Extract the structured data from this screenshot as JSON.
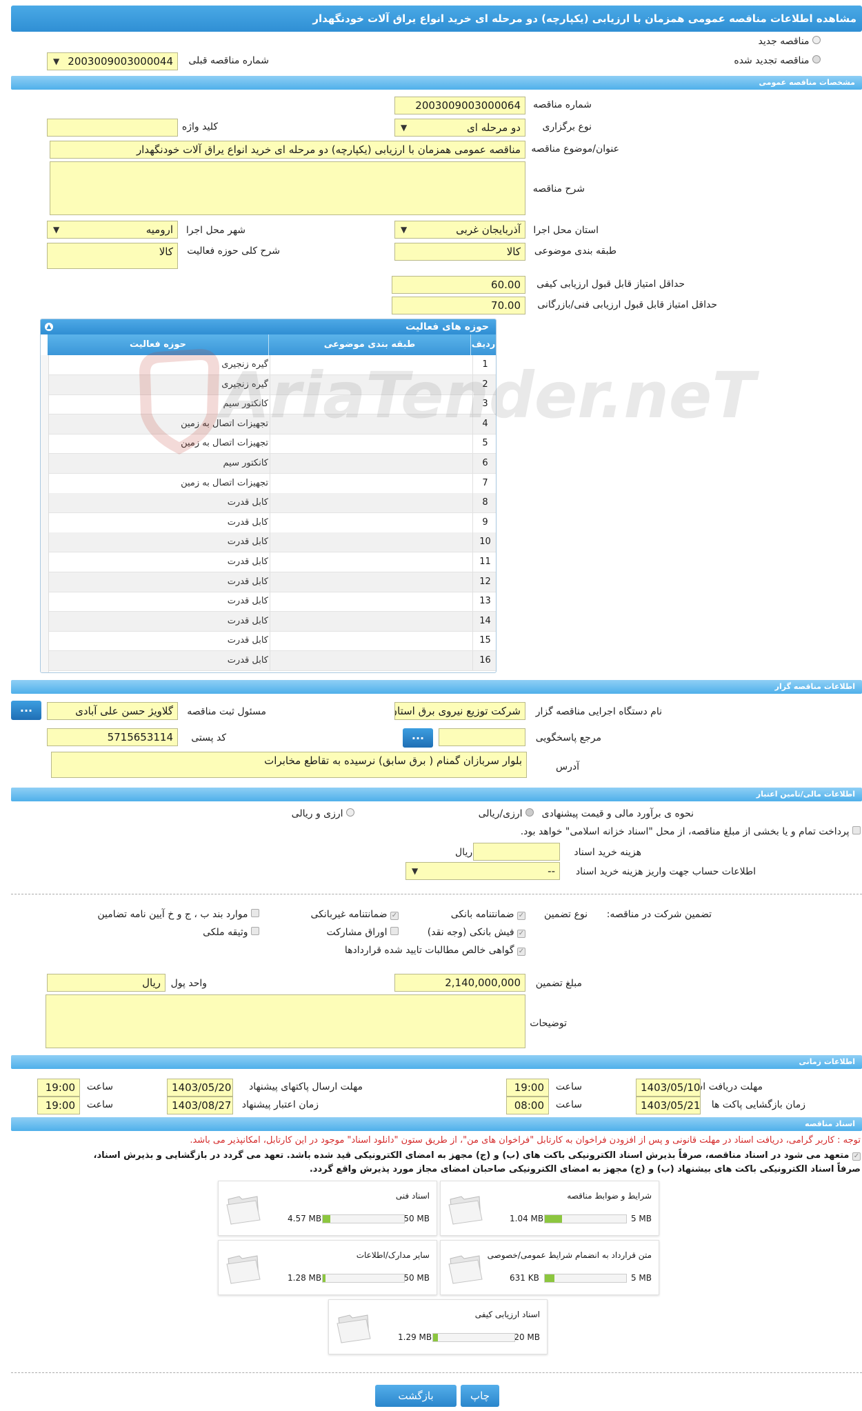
{
  "page_title": "مشاهده اطلاعات مناقصه عمومی همزمان با ارزیابی (یکپارچه) دو مرحله ای خرید انواع یراق آلات خودنگهدار",
  "tender_type_options": {
    "new": "مناقصه جدید",
    "renewed": "مناقصه تجدید شده"
  },
  "previous_tender": {
    "label": "شماره مناقصه قبلی",
    "value": "2003009003000044"
  },
  "general": {
    "section": "مشخصات مناقصه عمومی",
    "tender_number_label": "شماره مناقصه",
    "tender_number": "2003009003000064",
    "holding_type_label": "نوع برگزاری",
    "holding_type": "دو مرحله ای",
    "keyword_label": "کلید واژه",
    "keyword": "",
    "subject_label": "عنوان/موضوع مناقصه",
    "subject": "مناقصه عمومی همزمان با ارزیابی (یکپارچه) دو مرحله ای خرید انواع یراق آلات خودنگهدار",
    "description_label": "شرح مناقصه",
    "description": "",
    "province_label": "استان محل اجرا",
    "province": "آذربایجان غربی",
    "city_label": "شهر محل اجرا",
    "city": "ارومیه",
    "category_label": "طبقه بندی موضوعی",
    "category": "کالا",
    "activity_desc_label": "شرح کلی حوزه فعالیت",
    "activity_desc": "کالا",
    "min_quality_label": "حداقل امتیاز قابل قبول ارزیابی کیفی",
    "min_quality": "60.00",
    "min_technical_label": "حداقل امتیاز قابل قبول ارزیابی فنی/بازرگانی",
    "min_technical": "70.00"
  },
  "activity_grid": {
    "title": "حوزه های فعالیت",
    "col_row": "ردیف",
    "col_category": "طبقه بندی موضوعی",
    "col_activity": "حوزه فعالیت",
    "rows": [
      {
        "n": "1",
        "activity": "گیره زنجیری"
      },
      {
        "n": "2",
        "activity": "گیره زنجیری"
      },
      {
        "n": "3",
        "activity": "کانکتور سیم"
      },
      {
        "n": "4",
        "activity": "تجهیزات اتصال به زمین"
      },
      {
        "n": "5",
        "activity": "تجهیزات اتصال به زمین"
      },
      {
        "n": "6",
        "activity": "کانکتور سیم"
      },
      {
        "n": "7",
        "activity": "تجهیزات اتصال به زمین"
      },
      {
        "n": "8",
        "activity": "کابل قدرت"
      },
      {
        "n": "9",
        "activity": "کابل قدرت"
      },
      {
        "n": "10",
        "activity": "کابل قدرت"
      },
      {
        "n": "11",
        "activity": "کابل قدرت"
      },
      {
        "n": "12",
        "activity": "کابل قدرت"
      },
      {
        "n": "13",
        "activity": "کابل قدرت"
      },
      {
        "n": "14",
        "activity": "کابل قدرت"
      },
      {
        "n": "15",
        "activity": "کابل قدرت"
      },
      {
        "n": "16",
        "activity": "کابل قدرت"
      }
    ]
  },
  "watermark": "AriaTender.neT",
  "organizer": {
    "section": "اطلاعات مناقصه گزار",
    "org_name_label": "نام دستگاه اجرایی مناقصه گزار",
    "org_name": "شرکت توزیع نیروی برق استان",
    "registrar_label": "مسئول ثبت مناقصه",
    "registrar": "گلاویژ حسن علی آبادی",
    "dots": "...",
    "response_ref_label": "مرجع پاسخگویی",
    "response_ref": "",
    "postal_label": "کد پستی",
    "postal": "5715653114",
    "address_label": "آدرس",
    "address": "بلوار سربازان گمنام ( برق سابق) نرسیده به تقاطع مخابرات"
  },
  "finance": {
    "section": "اطلاعات مالی/تامین اعتبار",
    "estimate_label": "نحوه ی برآورد مالی و قیمت پیشنهادی",
    "opt1": "ارزی/ریالی",
    "opt2": "ارزی و ریالی",
    "treasury_note": "پرداخت تمام و یا بخشی از مبلغ مناقصه، از محل \"اسناد خزانه اسلامی\" خواهد بود.",
    "doc_cost_label": "هزینه خرید اسناد",
    "doc_cost": "",
    "doc_cost_unit": "ریال",
    "account_label": "اطلاعات حساب جهت واریز هزینه خرید اسناد",
    "account": "--"
  },
  "guarantee": {
    "label": "تضمین شرکت در مناقصه:",
    "type_label": "نوع تضمین",
    "types": [
      "ضمانتنامه بانکی",
      "ضمانتنامه غیربانکی",
      "موارد بند ب ، ج و خ آیین نامه تضامین",
      "فیش بانکی (وجه نقد)",
      "اوراق مشارکت",
      "وثیقه ملکی",
      "گواهی خالص مطالبات تایید شده قراردادها"
    ],
    "amount_label": "مبلغ تضمین",
    "amount": "2,140,000,000",
    "currency_label": "واحد پول",
    "currency": "ریال",
    "notes_label": "توضیحات",
    "notes": ""
  },
  "timing": {
    "section": "اطلاعات زمانی",
    "receive_deadline_label": "مهلت دریافت اسناد",
    "receive_deadline": "1403/05/10",
    "receive_time": "19:00",
    "send_deadline_label": "مهلت ارسال پاکتهای پیشنهاد",
    "send_deadline": "1403/05/20",
    "send_time": "19:00",
    "opening_label": "زمان بازگشایی پاکت ها",
    "opening": "1403/05/21",
    "opening_time": "08:00",
    "validity_label": "زمان اعتبار پیشنهاد",
    "validity": "1403/08/27",
    "validity_time": "19:00",
    "time_label": "ساعت"
  },
  "documents": {
    "section": "اسناد مناقصه",
    "notice": "توجه : کاربر گرامی، دریافت اسناد در مهلت قانونی و پس از افزودن فراخوان به کارتابل \"فراخوان های من\"، از طریق ستون \"دانلود اسناد\" موجود در این کارتابل، امکانپذیر می باشد.",
    "commit1": "متعهد می شود در اسناد مناقصه، صرفاً بذیرش اسناد الکترونیکی باکت های (ب) و (ج) مجهز به امضای الکترونیکی قید شده باشد. تعهد می گردد در بازگشایی و بذیرش اسناد،",
    "commit2": "صرفاً اسناد الکترونیکی باکت های بیشنهاد (ب) و (ج) مجهز به امضای الکترونیکی صاحبان امضای مجاز مورد پذیرش واقع گردد.",
    "files": [
      {
        "name": "شرایط و ضوابط مناقصه",
        "size": "1.04 MB",
        "max": "5 MB",
        "ratio": 0.21
      },
      {
        "name": "اسناد فنی",
        "size": "4.57 MB",
        "max": "50 MB",
        "ratio": 0.09
      },
      {
        "name": "متن قرارداد به انضمام شرایط عمومی/خصوصی",
        "size": "631 KB",
        "max": "5 MB",
        "ratio": 0.12
      },
      {
        "name": "سایر مدارک/اطلاعات",
        "size": "1.28 MB",
        "max": "50 MB",
        "ratio": 0.03
      },
      {
        "name": "اسناد ارزیابی کیفی",
        "size": "1.29 MB",
        "max": "20 MB",
        "ratio": 0.06
      }
    ]
  },
  "actions": {
    "print": "چاپ",
    "back": "بازگشت"
  }
}
